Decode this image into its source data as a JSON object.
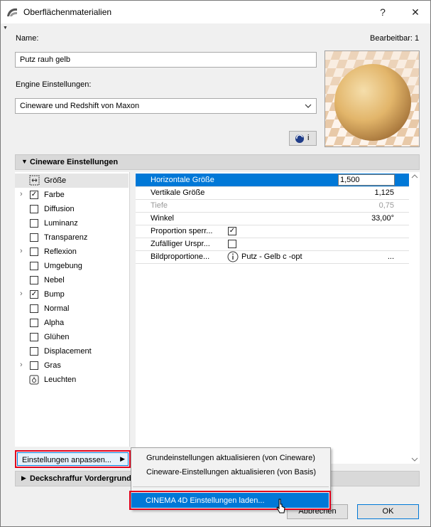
{
  "window": {
    "title": "Oberflächenmaterialien",
    "help_label": "?",
    "close_label": "✕"
  },
  "name_section": {
    "name_label": "Name:",
    "editable_label": "Bearbeitbar: 1",
    "name_value": "Putz rauh gelb"
  },
  "engine": {
    "label": "Engine Einstellungen:",
    "selected": "Cineware und Redshift von Maxon"
  },
  "preview": {
    "info_label": "i"
  },
  "cineware_section": {
    "title": "Cineware Einstellungen",
    "channels": [
      {
        "label": "Größe",
        "check": "none",
        "expandable": false,
        "selected": true
      },
      {
        "label": "Farbe",
        "check": "checked",
        "expandable": true
      },
      {
        "label": "Diffusion",
        "check": "unchecked",
        "expandable": false
      },
      {
        "label": "Luminanz",
        "check": "unchecked",
        "expandable": false
      },
      {
        "label": "Transparenz",
        "check": "unchecked",
        "expandable": false
      },
      {
        "label": "Reflexion",
        "check": "unchecked",
        "expandable": true
      },
      {
        "label": "Umgebung",
        "check": "unchecked",
        "expandable": false
      },
      {
        "label": "Nebel",
        "check": "unchecked",
        "expandable": false
      },
      {
        "label": "Bump",
        "check": "checked",
        "expandable": true
      },
      {
        "label": "Normal",
        "check": "unchecked",
        "expandable": false
      },
      {
        "label": "Alpha",
        "check": "unchecked",
        "expandable": false
      },
      {
        "label": "Glühen",
        "check": "unchecked",
        "expandable": false
      },
      {
        "label": "Displacement",
        "check": "unchecked",
        "expandable": false
      },
      {
        "label": "Gras",
        "check": "unchecked",
        "expandable": true
      },
      {
        "label": "Leuchten",
        "check": "special",
        "expandable": false
      }
    ],
    "properties": [
      {
        "name": "Horizontale Größe",
        "value": "1,500"
      },
      {
        "name": "Vertikale Größe",
        "value": "1,125"
      },
      {
        "name": "Tiefe",
        "value": "0,75"
      },
      {
        "name": "Winkel",
        "value": "33,00°"
      },
      {
        "name": "Proportion sperr...",
        "value": ""
      },
      {
        "name": "Zufälliger Urspr...",
        "value": ""
      },
      {
        "name": "Bildproportione...",
        "value": "Putz - Gelb c -opt",
        "extra": "..."
      }
    ]
  },
  "adjust_button": {
    "label": "Einstellungen anpassen...",
    "arrow": "▶"
  },
  "context_menu": {
    "items": [
      "Grundeinstellungen aktualisieren (von Cineware)",
      "Cineware-Einstellungen aktualisieren (von Basis)",
      "CINEMA 4D Einstellungen laden..."
    ]
  },
  "hatch_section": {
    "title": "Deckschraffur Vordergrund"
  },
  "footer": {
    "cancel": "Abbrechen",
    "ok": "OK"
  }
}
